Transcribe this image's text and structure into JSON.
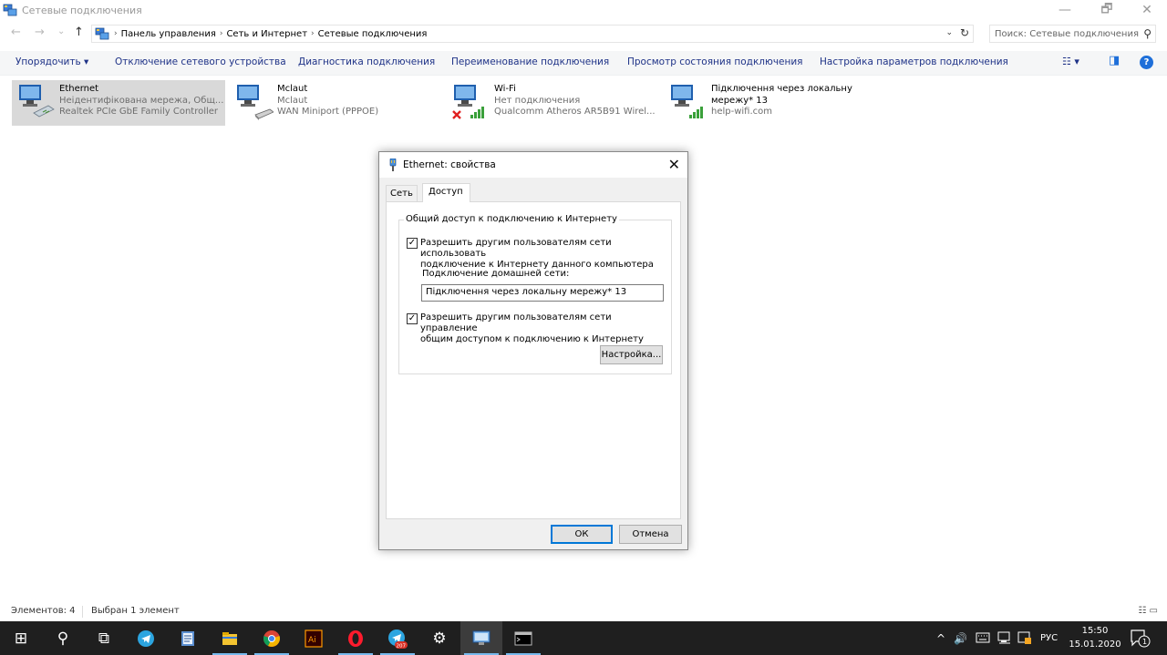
{
  "window": {
    "title": "Сетевые подключения",
    "minimize_glyph": "—",
    "restore_glyph": "🗗",
    "close_glyph": "✕"
  },
  "nav": {
    "back_glyph": "←",
    "forward_glyph": "→",
    "recent_glyph": "⌄",
    "up_glyph": "↑"
  },
  "address": {
    "breadcrumbs": [
      "Панель управления",
      "Сеть и Интернет",
      "Сетевые подключения"
    ],
    "separator": "›",
    "dropdown_glyph": "⌄",
    "refresh_glyph": "↻"
  },
  "search": {
    "placeholder": "Поиск: Сетевые подключения",
    "icon_glyph": "⚲"
  },
  "commands": {
    "organize": "Упорядочить ▾",
    "disable": "Отключение сетевого устройства",
    "diagnose": "Диагностика подключения",
    "rename": "Переименование подключения",
    "status": "Просмотр состояния подключения",
    "settings": "Настройка параметров подключения",
    "view_glyph": "☷ ▾",
    "pane_glyph": "◨",
    "help_glyph": "?"
  },
  "connections": [
    {
      "name": "Ethernet",
      "status": "Неідентифікована мережа, Общ...",
      "device": "Realtek PCIe GbE Family Controller"
    },
    {
      "name": "Mclaut",
      "status": "Mclaut",
      "device": "WAN Miniport (PPPOE)"
    },
    {
      "name": "Wi-Fi",
      "status": "Нет подключения",
      "device": "Qualcomm Atheros AR5B91 Wirel..."
    },
    {
      "name": "Підключення через локальну",
      "status": "мережу* 13",
      "device": "help-wifi.com"
    }
  ],
  "dialog": {
    "title": "Ethernet: свойства",
    "close_glyph": "✕",
    "tabs": [
      "Сеть",
      "Доступ"
    ],
    "group_label": "Общий доступ к подключению к Интернету",
    "check1_line1": "Разрешить другим пользователям сети использовать",
    "check1_line2": "подключение к Интернету данного компьютера",
    "check1_mark": "✓",
    "home_label": "Подключение домашней сети:",
    "home_value": "Підключення через локальну мережу* 13",
    "check2_line1": "Разрешить другим пользователям сети управление",
    "check2_line2": "общим доступом к подключению к Интернету",
    "check2_mark": "✓",
    "settings_button": "Настройка...",
    "ok_button": "ОК",
    "cancel_button": "Отмена"
  },
  "statusbar": {
    "items_count": "Элементов: 4",
    "selected": "Выбран 1 элемент",
    "view_glyphs": "☷ ▭"
  },
  "taskbar": {
    "start_glyph": "⊞",
    "search_glyph": "⚲",
    "taskview_glyph": "⧉",
    "telegram_badge": "207",
    "settings_glyph": "⚙",
    "tray_arrow": "^",
    "volume_glyph": "🔊",
    "lang": "РУС",
    "time": "15:50",
    "date": "15.01.2020",
    "notifications_count": "1"
  },
  "colors": {
    "accent": "#0078d7",
    "command_text": "#1e3287",
    "taskbar_bg": "#1f1f1f"
  }
}
